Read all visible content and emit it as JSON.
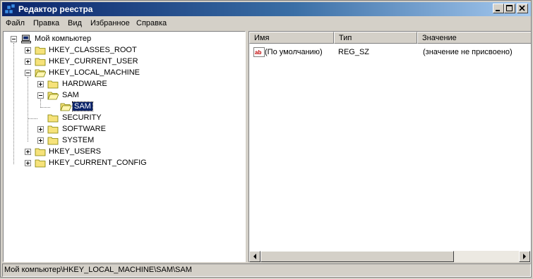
{
  "window": {
    "title": "Редактор реестра"
  },
  "menu": [
    "Файл",
    "Правка",
    "Вид",
    "Избранное",
    "Справка"
  ],
  "tree": {
    "root": "Мой компьютер",
    "hives": {
      "classes_root": "HKEY_CLASSES_ROOT",
      "current_user": "HKEY_CURRENT_USER",
      "local_machine": "HKEY_LOCAL_MACHINE",
      "users": "HKEY_USERS",
      "current_config": "HKEY_CURRENT_CONFIG"
    },
    "local_machine_children": {
      "hardware": "HARDWARE",
      "sam": "SAM",
      "sam_child": "SAM",
      "security": "SECURITY",
      "software": "SOFTWARE",
      "system": "SYSTEM"
    }
  },
  "list": {
    "columns": {
      "name": "Имя",
      "type": "Тип",
      "value": "Значение"
    },
    "rows": [
      {
        "icon": "string-value-icon",
        "name": "(По умолчанию)",
        "type": "REG_SZ",
        "value": "(значение не присвоено)"
      }
    ]
  },
  "statusbar": {
    "path": "Мой компьютер\\HKEY_LOCAL_MACHINE\\SAM\\SAM"
  },
  "colors": {
    "title_start": "#0a246a",
    "title_end": "#a6caf0",
    "selection": "#0a246a",
    "folder": "#f6e27a"
  }
}
